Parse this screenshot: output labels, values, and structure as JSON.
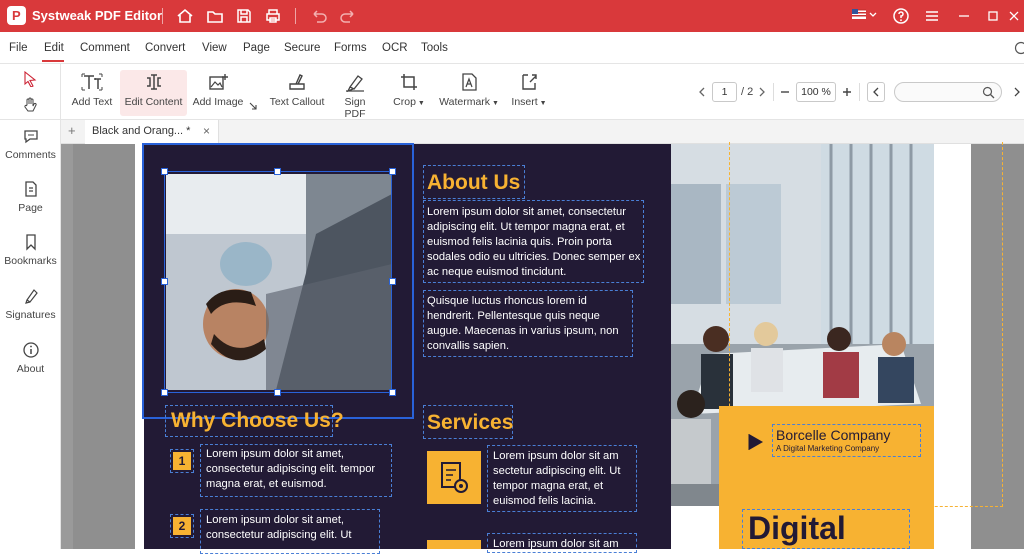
{
  "app": {
    "title": "Systweak PDF Editor",
    "logo_letter": "P"
  },
  "menu": [
    "File",
    "Edit",
    "Comment",
    "Convert",
    "View",
    "Page",
    "Secure",
    "Forms",
    "OCR",
    "Tools"
  ],
  "toolbar": {
    "tools": [
      "Add Text",
      "Edit Content",
      "Add Image",
      "Text Callout",
      "Sign PDF",
      "Crop",
      "Watermark",
      "Insert"
    ],
    "page_current": "1",
    "page_total": "/ 2",
    "zoom": "100 %"
  },
  "sidebar": [
    "Comments",
    "Page",
    "Bookmarks",
    "Signatures",
    "About"
  ],
  "tab": {
    "name": "Black and Orang... *",
    "close": "×",
    "add": "+"
  },
  "doc": {
    "about_heading": "About Us",
    "about_p1": "Lorem ipsum dolor sit amet, consectetur adipiscing elit. Ut tempor magna erat, et euismod felis lacinia quis. Proin porta sodales odio eu ultricies. Donec semper ex ac neque euismod tincidunt.",
    "about_p2": "Quisque luctus rhoncus lorem id hendrerit. Pellentesque quis neque augue. Maecenas in varius ipsum, non convallis sapien.",
    "why_heading": "Why Choose Us?",
    "why_1_num": "1",
    "why_1_text": "Lorem ipsum dolor sit amet, consectetur adipiscing elit. tempor magna erat, et euismod.",
    "why_2_num": "2",
    "why_2_text": "Lorem ipsum dolor sit amet, consectetur adipiscing elit. Ut",
    "services_heading": "Services",
    "services_1_text": "Lorem ipsum dolor sit am sectetur adipiscing elit. Ut tempor magna erat, et euismod felis lacinia.",
    "services_2_text": "Lorem ipsum dolor sit am",
    "company_name": "Borcelle Company",
    "company_tagline": "A Digital Marketing Company",
    "big_heading": "Digital Marketing"
  },
  "colors": {
    "titlebar": "#d9393b",
    "doc_dark": "#221a35",
    "accent_orange": "#f7b232",
    "selection": "#2962d9"
  }
}
